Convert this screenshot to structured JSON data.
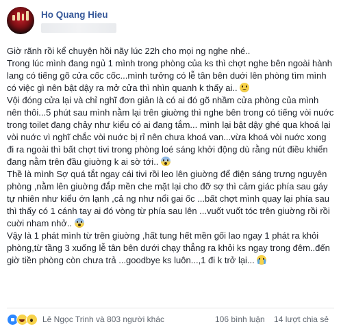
{
  "post": {
    "author": "Ho Quang Hieu",
    "avatar_icon": "avatar-image",
    "paragraphs": [
      {
        "text": "Giờ rãnh rồi kể chuyện hồi nãy lúc 22h cho mọi ng nghe nhé..",
        "emoji": null
      },
      {
        "text": "Trong lúc mình đang ngủ 1 mình trong phòng của ks thì chợt nghe bên ngoài hành lang có tiếng gõ cửa cốc cốc...mình tưởng có lễ tân bên duới lên phòng tìm mình có việc gì nên bật dậy ra mở cửa thì nhìn quanh k thấy ai..",
        "emoji": "worried-face"
      },
      {
        "text": "Vội đóng cửa lại và chỉ nghĩ đơn giản là có ai đó gõ nhầm cửa phòng của mình nên thôi...5 phút sau mình nằm lại trên giuờng thì nghe bên trong có tiếng vòi nuớc trong toilet đang chảy như kiểu có ai đang tắm... mình lại bật dậy ghé qua khoá lại vòi nuớc vì nghĩ chắc vòi nuớc bị rỉ nên chưa khoá van...vừa khoá vòi nuớc xong đi ra ngoài thì bất chợt tivi trong phòng loé sáng khởi động dù rằng nút điều khiển đang nằm trên đầu giuờng k ai sờ tới..",
        "emoji": "fear-face"
      },
      {
        "text": "Thề là mình Sợ quá tắt ngay cái tivi rồi leo lên giuờng để điện sáng trưng nguyên phòng ,nằm lên giuờng đắp mền che mặt lại cho đỡ sợ thì cảm giác phía sau gáy tự nhiên như kiểu ớn lạnh ,cả ng như nổi gai ốc ...bất chợt mình quay lại phía sau thì thấy có 1 cánh tay ai đó vòng từ phía sau lên ...vuốt vuốt tóc trên giuờng rồi rồi cuời nham nhở..",
        "emoji": "fear-face"
      },
      {
        "text": "Vậy là 1 phát mình từ trên giuờng ,hất tung hết mền gối lao ngay 1 phát ra khỏi phòng,từ tầng 3 xuống lễ tân bên dưới chạy thẳng ra khỏi ks ngay trong đêm..đến giờ tiền phòng còn chưa trả ...goodbye ks luôn...,1 đi k trở lại...",
        "emoji": "crying-face"
      }
    ],
    "reactions": {
      "icons": [
        "like-icon",
        "haha-icon",
        "wow-icon"
      ],
      "text": "Lê Ngọc Trinh và 803 người khác"
    },
    "counts": {
      "comments": "106 bình luận",
      "shares": "14 lượt chia sẻ"
    }
  }
}
